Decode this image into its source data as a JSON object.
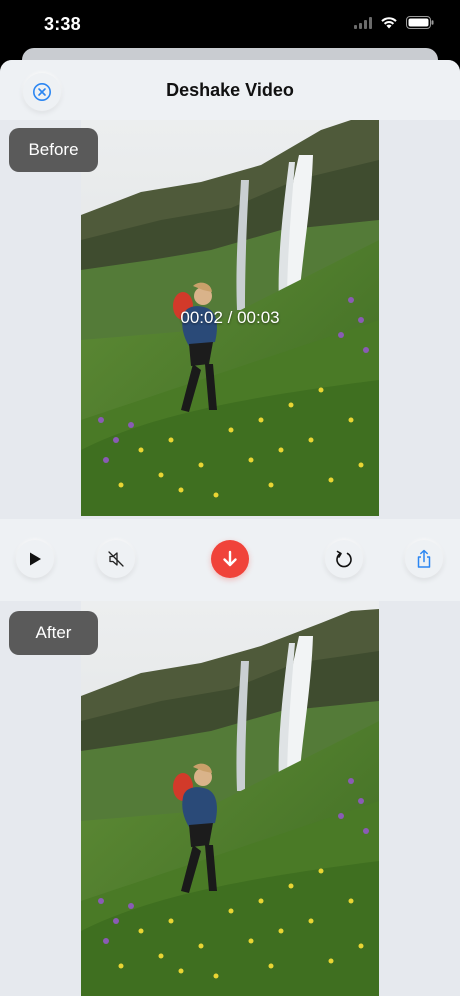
{
  "status_bar": {
    "time": "3:38"
  },
  "header": {
    "title": "Deshake Video",
    "close_icon": "close-circle-icon"
  },
  "before": {
    "label": "Before",
    "time_overlay": "00:02 / 00:03"
  },
  "controls": {
    "play_icon": "play-icon",
    "mute_icon": "mute-icon",
    "download_icon": "download-arrow-icon",
    "rotate_icon": "rotate-icon",
    "share_icon": "share-icon"
  },
  "after": {
    "label": "After"
  },
  "colors": {
    "accent_blue": "#2b86f2",
    "download_red": "#f0433a",
    "label_gray": "#5a5a5a",
    "background": "#e6e9ee"
  }
}
